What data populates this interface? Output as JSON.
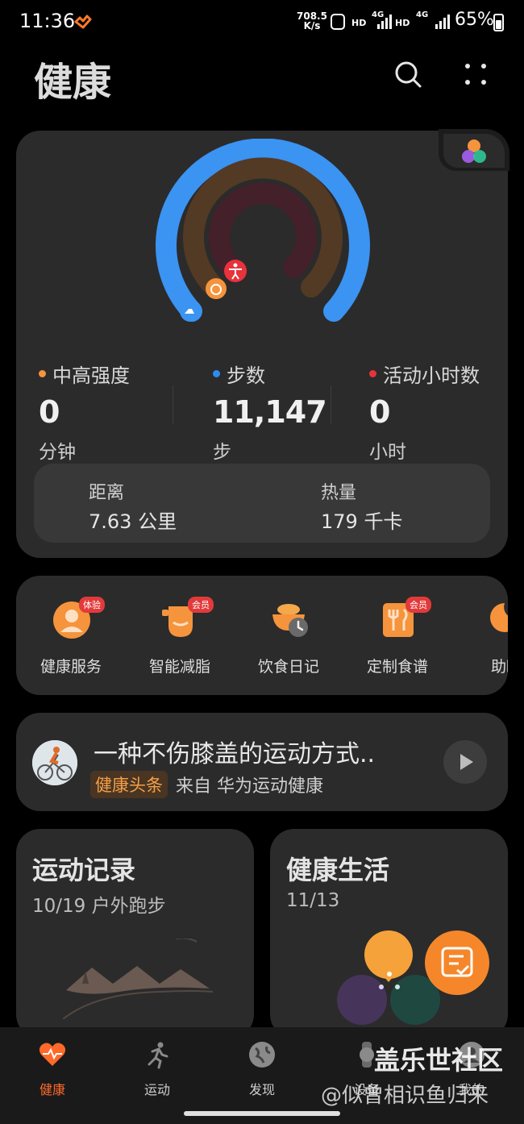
{
  "status_bar": {
    "time": "11:36",
    "net_speed_value": "708.5",
    "net_speed_unit": "K/s",
    "hd1": "HD",
    "net1": "4G",
    "hd2": "HD",
    "net2": "4G",
    "battery": "65%"
  },
  "header": {
    "title": "健康"
  },
  "activity": {
    "stats": [
      {
        "label": "中高强度",
        "value": "0",
        "unit": "分钟",
        "color": "#f5943c"
      },
      {
        "label": "步数",
        "value": "11,147",
        "unit": "步",
        "color": "#2b8cf5"
      },
      {
        "label": "活动小时数",
        "value": "0",
        "unit": "小时",
        "color": "#e8323c"
      }
    ],
    "distance": {
      "label": "距离",
      "value": "7.63 公里"
    },
    "calories": {
      "label": "热量",
      "value": "179 千卡"
    }
  },
  "services": [
    {
      "name": "健康服务",
      "badge": "体验",
      "icon": "health-service-icon"
    },
    {
      "name": "智能减脂",
      "badge": "会员",
      "icon": "fat-loss-icon"
    },
    {
      "name": "饮食日记",
      "badge": "",
      "icon": "diet-diary-icon"
    },
    {
      "name": "定制食谱",
      "badge": "会员",
      "icon": "recipe-icon"
    },
    {
      "name": "助眠",
      "badge": "",
      "icon": "sleep-aid-icon"
    }
  ],
  "article": {
    "title": "一种不伤膝盖的运动方式..",
    "tag": "健康头条",
    "from": "来自 华为运动健康"
  },
  "cards": {
    "exercise": {
      "title": "运动记录",
      "subtitle": "10/19 户外跑步"
    },
    "life": {
      "title": "健康生活",
      "subtitle": "11/13"
    }
  },
  "tabs": [
    {
      "label": "健康",
      "active": true
    },
    {
      "label": "运动",
      "active": false
    },
    {
      "label": "发现",
      "active": false
    },
    {
      "label": "设备",
      "active": false
    },
    {
      "label": "我的",
      "active": false
    }
  ],
  "watermark": {
    "line1": "盖乐世社区",
    "line2": "@似曾相识鱼归来"
  },
  "colors": {
    "accent": "#ff6a2a",
    "steps_ring": "#3b93f2",
    "intensity_ring": "#5a3d24",
    "hours_ring": "#4a2025"
  }
}
